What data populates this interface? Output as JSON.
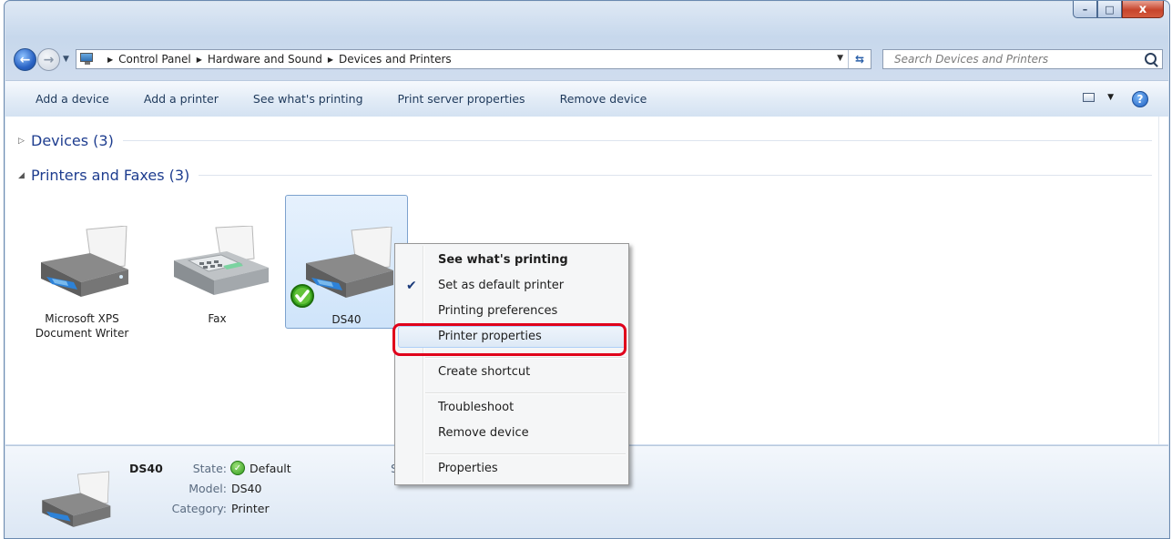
{
  "window": {
    "caption_min": "–",
    "caption_max": "□",
    "caption_close": "x"
  },
  "address": {
    "crumbs": [
      "Control Panel",
      "Hardware and Sound",
      "Devices and Printers"
    ],
    "search_placeholder": "Search Devices and Printers"
  },
  "toolbar": {
    "add_device": "Add a device",
    "add_printer": "Add a printer",
    "see_whats_printing": "See what's printing",
    "print_server_properties": "Print server properties",
    "remove_device": "Remove device",
    "help": "?"
  },
  "groups": {
    "devices": {
      "title": "Devices (3)",
      "expanded": false
    },
    "printers": {
      "title": "Printers and Faxes (3)",
      "expanded": true
    }
  },
  "printers": [
    {
      "label": "Microsoft XPS Document Writer",
      "icon": "printer-icon"
    },
    {
      "label": "Fax",
      "icon": "fax-icon"
    },
    {
      "label": "DS40",
      "icon": "printer-icon",
      "default": true,
      "selected": true
    }
  ],
  "context_menu": {
    "items": [
      {
        "label": "See what's printing",
        "bold": true
      },
      {
        "label": "Set as default printer",
        "checked": true
      },
      {
        "label": "Printing preferences"
      },
      {
        "label": "Printer properties",
        "highlighted": true
      },
      {
        "label": "Create shortcut"
      },
      {
        "label": "Troubleshoot"
      },
      {
        "label": "Remove device"
      },
      {
        "label": "Properties"
      }
    ]
  },
  "details": {
    "name": "DS40",
    "state_key": "State:",
    "state_value": "Default",
    "model_key": "Model:",
    "model_value": "DS40",
    "category_key": "Category:",
    "category_value": "Printer",
    "overflow_char": "S"
  },
  "colors": {
    "highlight_callout": "#e0001b",
    "group_title": "#1e3d8f",
    "command_text": "#1e395b"
  }
}
